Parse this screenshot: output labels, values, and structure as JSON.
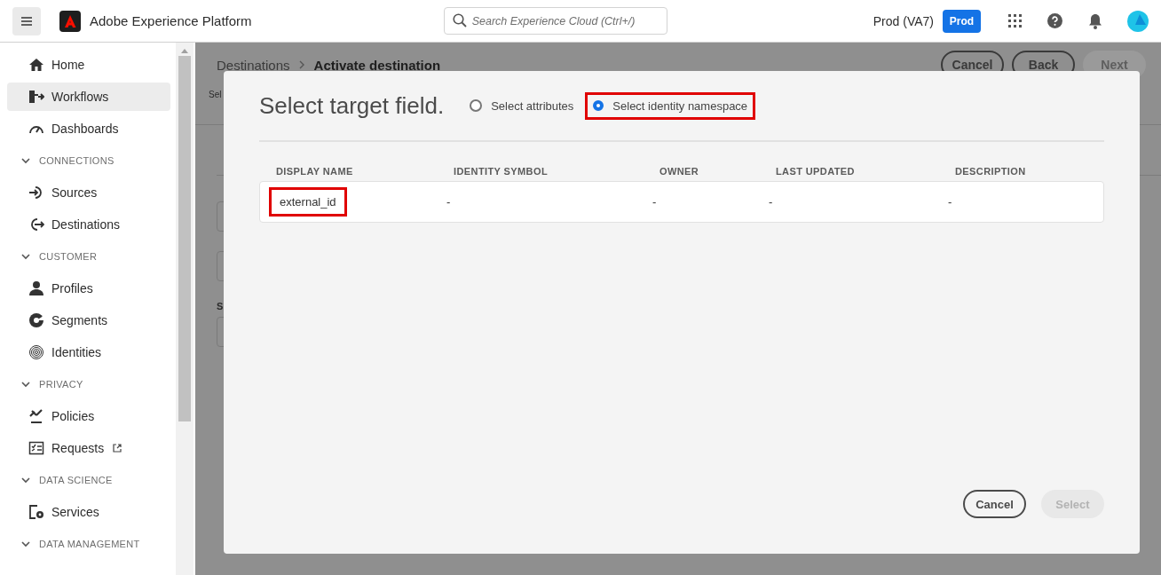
{
  "header": {
    "app_title": "Adobe Experience Platform",
    "search": {
      "placeholder": "Search Experience Cloud (Ctrl+/)"
    },
    "org": "Prod (VA7)",
    "sandbox_badge": "Prod"
  },
  "sidebar": {
    "items": [
      {
        "kind": "item",
        "label": "Home",
        "selected": false
      },
      {
        "kind": "item",
        "label": "Workflows",
        "selected": true
      },
      {
        "kind": "item",
        "label": "Dashboards",
        "selected": false
      },
      {
        "kind": "section",
        "label": "CONNECTIONS",
        "expanded": true
      },
      {
        "kind": "item",
        "label": "Sources",
        "selected": false
      },
      {
        "kind": "item",
        "label": "Destinations",
        "selected": false
      },
      {
        "kind": "section",
        "label": "CUSTOMER",
        "expanded": true
      },
      {
        "kind": "item",
        "label": "Profiles",
        "selected": false
      },
      {
        "kind": "item",
        "label": "Segments",
        "selected": false
      },
      {
        "kind": "item",
        "label": "Identities",
        "selected": false
      },
      {
        "kind": "section",
        "label": "PRIVACY",
        "expanded": true
      },
      {
        "kind": "item",
        "label": "Policies",
        "selected": false
      },
      {
        "kind": "item",
        "label": "Requests",
        "selected": false,
        "external": true
      },
      {
        "kind": "section",
        "label": "DATA SCIENCE",
        "expanded": true
      },
      {
        "kind": "item",
        "label": "Services",
        "selected": false
      },
      {
        "kind": "section",
        "label": "DATA MANAGEMENT",
        "expanded": true
      }
    ]
  },
  "background_page": {
    "breadcrumb_parent": "Destinations",
    "breadcrumb_current": "Activate destination",
    "fragments": [
      "Sel",
      "S"
    ],
    "buttons": [
      {
        "label": "Cancel",
        "disabled": false
      },
      {
        "label": "Back",
        "disabled": false
      },
      {
        "label": "Next",
        "disabled": true
      }
    ]
  },
  "dialog": {
    "title": "Select target field.",
    "options": [
      {
        "label": "Select attributes",
        "selected": false,
        "highlighted": false
      },
      {
        "label": "Select identity namespace",
        "selected": true,
        "highlighted": true
      }
    ],
    "table": {
      "columns": [
        "DISPLAY NAME",
        "IDENTITY SYMBOL",
        "OWNER",
        "LAST UPDATED",
        "DESCRIPTION"
      ],
      "rows": [
        {
          "cells": [
            {
              "text": "external_id",
              "highlighted": true
            },
            {
              "text": "-",
              "highlighted": false
            },
            {
              "text": "-",
              "highlighted": false
            },
            {
              "text": "-",
              "highlighted": false
            },
            {
              "text": "-",
              "highlighted": false
            }
          ]
        }
      ]
    },
    "buttons": [
      {
        "label": "Cancel",
        "disabled": false
      },
      {
        "label": "Select",
        "disabled": true
      }
    ]
  }
}
